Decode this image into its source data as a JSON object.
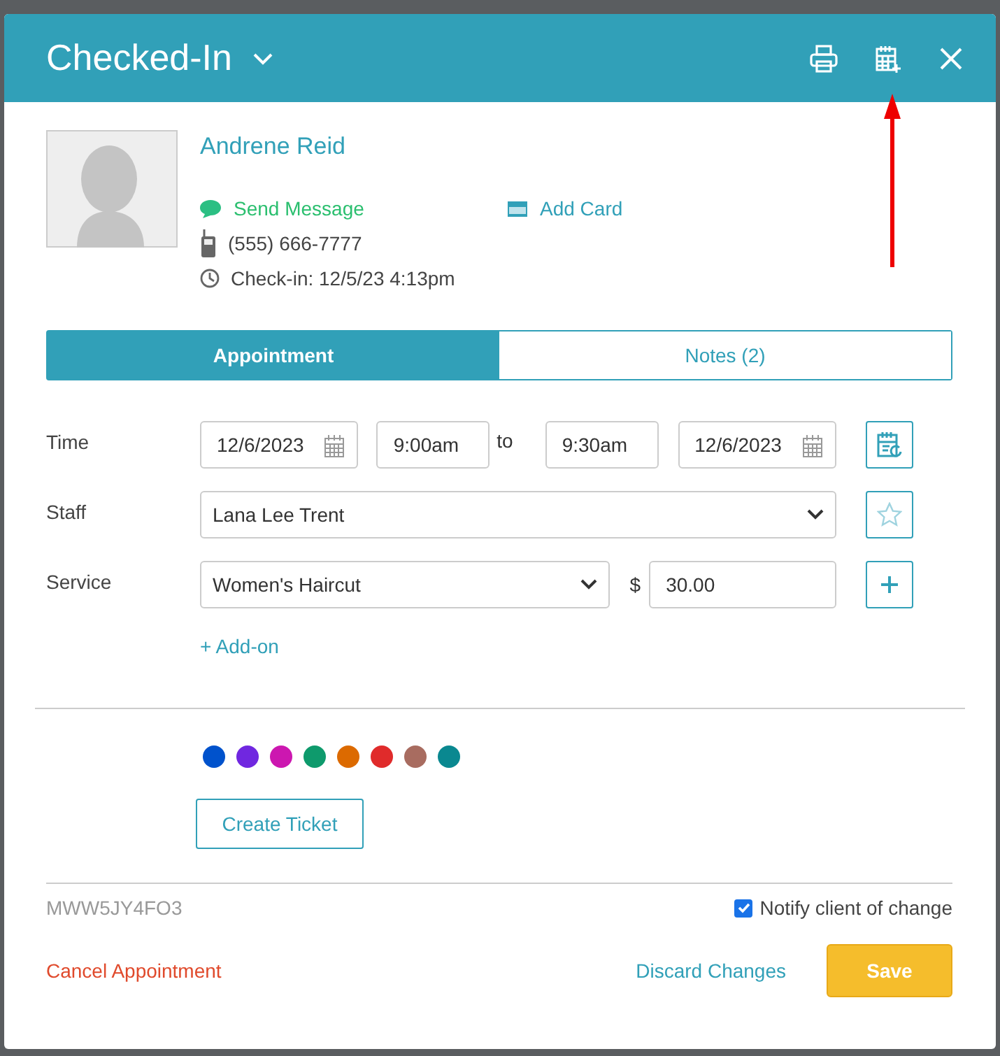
{
  "header": {
    "status": "Checked-In"
  },
  "client": {
    "name": "Andrene Reid",
    "send_message": "Send Message",
    "add_card": "Add Card",
    "phone": "(555) 666-7777",
    "checkin": "Check-in: 12/5/23 4:13pm"
  },
  "tabs": [
    {
      "label": "Appointment",
      "selected": true
    },
    {
      "label": "Notes (2)",
      "selected": false
    }
  ],
  "time": {
    "label": "Time",
    "start_date": "12/6/2023",
    "start_time": "9:00am",
    "to": "to",
    "end_time": "9:30am",
    "end_date": "12/6/2023"
  },
  "staff": {
    "label": "Staff",
    "value": "Lana Lee Trent"
  },
  "service": {
    "label": "Service",
    "value": "Women's Haircut",
    "currency": "$",
    "price": "30.00",
    "add_on": "+ Add-on"
  },
  "colors": [
    {
      "color": "#0052cc"
    },
    {
      "color": "#7027e0"
    },
    {
      "color": "#cc17b0"
    },
    {
      "color": "#0e9a6c"
    },
    {
      "color": "#dc6a00"
    },
    {
      "color": "#e02b2b"
    },
    {
      "color": "#a86c60"
    },
    {
      "color": "#0a8890"
    }
  ],
  "create_ticket": "Create Ticket",
  "code": "MWW5JY4FO3",
  "notify": {
    "label": "Notify client of change",
    "checked": true
  },
  "footer": {
    "cancel": "Cancel Appointment",
    "discard": "Discard Changes",
    "save": "Save"
  }
}
